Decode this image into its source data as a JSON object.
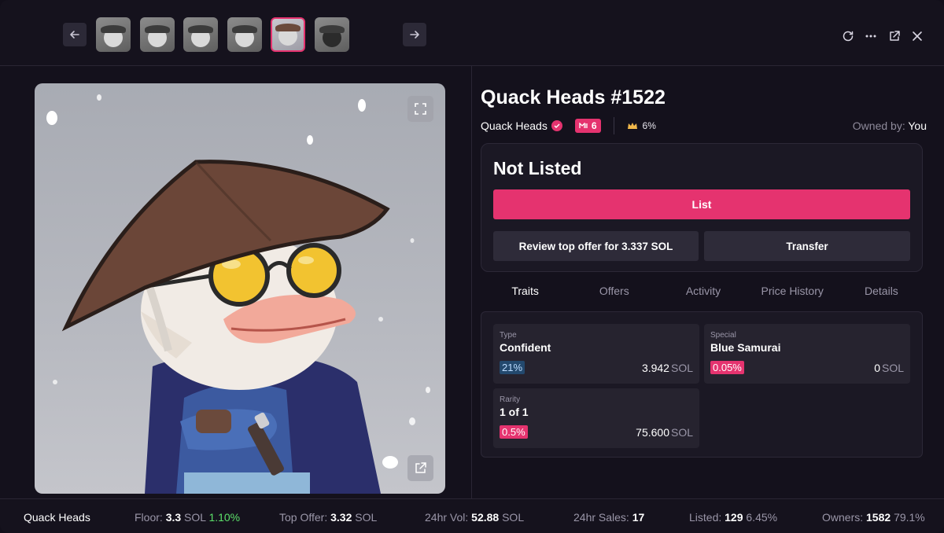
{
  "topbar": {
    "thumbnails": [
      {
        "name": "thumb-1",
        "active": false
      },
      {
        "name": "thumb-2",
        "active": false
      },
      {
        "name": "thumb-3",
        "active": false
      },
      {
        "name": "thumb-4",
        "active": false
      },
      {
        "name": "thumb-5",
        "active": true
      },
      {
        "name": "thumb-6",
        "active": false
      }
    ],
    "icons": [
      "arrow-left-icon",
      "arrow-right-icon",
      "refresh-icon",
      "more-icon",
      "external-link-icon",
      "close-icon"
    ]
  },
  "nft": {
    "title": "Quack Heads #1522",
    "collection": "Quack Heads",
    "me_badge": "6",
    "rarity_pct": "6%",
    "owned_by_label": "Owned by:",
    "owned_by_value": "You"
  },
  "listing": {
    "status": "Not Listed",
    "list_label": "List",
    "review_offer_label": "Review top offer for 3.337 SOL",
    "transfer_label": "Transfer"
  },
  "tabs": [
    "Traits",
    "Offers",
    "Activity",
    "Price History",
    "Details"
  ],
  "traits": [
    {
      "label": "Type",
      "value": "Confident",
      "pct": "21%",
      "price": "3.942",
      "unit": "SOL",
      "pct_style": "blue"
    },
    {
      "label": "Special",
      "value": "Blue Samurai",
      "pct": "0.05%",
      "price": "0",
      "unit": "SOL",
      "pct_style": "pink"
    },
    {
      "label": "Rarity",
      "value": "1 of 1",
      "pct": "0.5%",
      "price": "75.600",
      "unit": "SOL",
      "pct_style": "pink"
    }
  ],
  "stats": {
    "collection": "Quack Heads",
    "floor_label": "Floor:",
    "floor_value": "3.3",
    "floor_unit": "SOL",
    "floor_change": "1.10%",
    "top_offer_label": "Top Offer:",
    "top_offer_value": "3.32",
    "top_offer_unit": "SOL",
    "vol_label": "24hr Vol:",
    "vol_value": "52.88",
    "vol_unit": "SOL",
    "sales_label": "24hr Sales:",
    "sales_value": "17",
    "listed_label": "Listed:",
    "listed_value": "129",
    "listed_pct": "6.45%",
    "owners_label": "Owners:",
    "owners_value": "1582",
    "owners_pct": "79.1%"
  },
  "colors": {
    "accent": "#e5336f",
    "background": "#14111c",
    "card": "#1b1824",
    "green": "#5ce06a"
  }
}
